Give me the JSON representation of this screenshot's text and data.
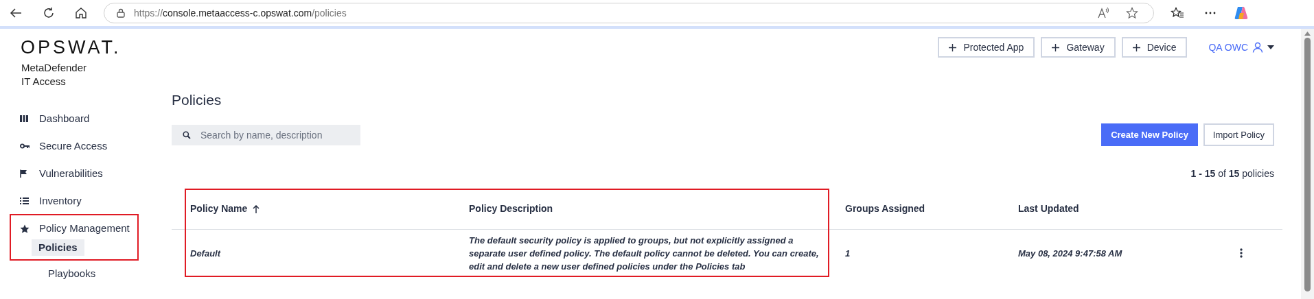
{
  "browser": {
    "url": {
      "scheme": "https://",
      "host": "console.metaaccess-c.opswat.com",
      "path": "/policies"
    }
  },
  "sidebar": {
    "logo": "OPSWAT.",
    "product": [
      "MetaDefender",
      "IT Access"
    ],
    "items": [
      {
        "label": "Dashboard",
        "selected": false,
        "highlighted": false
      },
      {
        "label": "Secure Access",
        "selected": false,
        "highlighted": false
      },
      {
        "label": "Vulnerabilities",
        "selected": false,
        "highlighted": false
      },
      {
        "label": "Inventory",
        "selected": false,
        "highlighted": false
      },
      {
        "label": "Policy Management",
        "selected": false,
        "highlighted": true,
        "children": [
          {
            "label": "Policies",
            "selected": true
          },
          {
            "label": "Playbooks",
            "selected": false
          }
        ]
      }
    ]
  },
  "header": {
    "buttons": [
      "Protected App",
      "Gateway",
      "Device"
    ],
    "user": "QA OWC"
  },
  "page": {
    "title": "Policies",
    "search": {
      "placeholder": "Search by name, description"
    },
    "actions": [
      {
        "label": "Create New Policy",
        "kind": "primary"
      },
      {
        "label": "Import Policy",
        "kind": "secondary"
      }
    ],
    "count": "**1 - 15** of **15** policies"
  },
  "table": {
    "columns": [
      {
        "label": "Policy Name",
        "sorted": true,
        "highlighted": true
      },
      {
        "label": "Policy Description",
        "sorted": false,
        "highlighted": true
      },
      {
        "label": "Groups Assigned",
        "sorted": false,
        "highlighted": false
      },
      {
        "label": "Last Updated",
        "sorted": false,
        "highlighted": false
      }
    ],
    "rows": [
      {
        "cells": [
          "Default",
          "The default security policy is applied to groups, but not explicitly assigned a separate user defined policy. The default policy cannot be deleted. You can create, edit and delete a new user defined policies under the Policies tab",
          "1",
          "May 08, 2024 9:47:58 AM"
        ],
        "has_menu": true
      }
    ]
  }
}
